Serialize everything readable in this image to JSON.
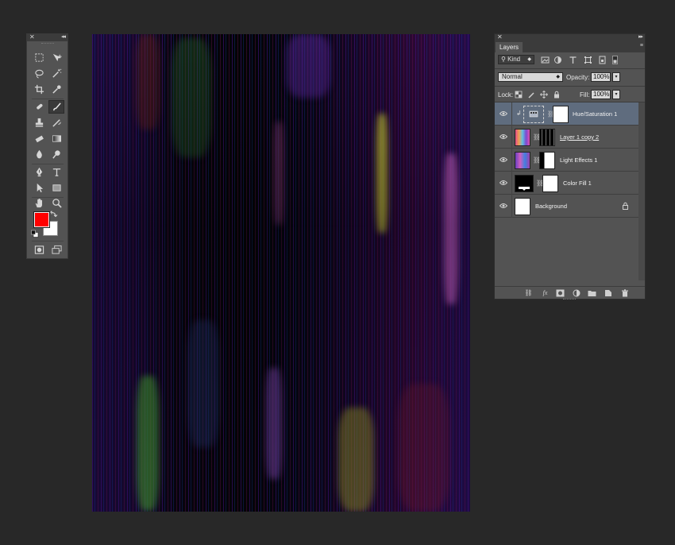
{
  "toolbox": {
    "close_glyph": "✕",
    "collapse_glyph": "◂◂",
    "tools": [
      {
        "name": "rectangular-marquee-tool-icon",
        "glyph": "⬚"
      },
      {
        "name": "move-tool-icon",
        "glyph": "✥"
      },
      {
        "name": "lasso-tool-icon",
        "glyph": "ଡ"
      },
      {
        "name": "magic-wand-tool-icon",
        "glyph": "✦"
      },
      {
        "name": "crop-tool-icon",
        "glyph": "⌗"
      },
      {
        "name": "eyedropper-tool-icon",
        "glyph": "✎"
      },
      {
        "name": "healing-brush-tool-icon",
        "glyph": "✚"
      },
      {
        "name": "brush-tool-icon",
        "glyph": "⁄"
      },
      {
        "name": "clone-stamp-tool-icon",
        "glyph": "⊥"
      },
      {
        "name": "history-brush-tool-icon",
        "glyph": "↯"
      },
      {
        "name": "eraser-tool-icon",
        "glyph": "◪"
      },
      {
        "name": "gradient-tool-icon",
        "glyph": "▭"
      },
      {
        "name": "blur-tool-icon",
        "glyph": "◖"
      },
      {
        "name": "dodge-tool-icon",
        "glyph": "●"
      },
      {
        "name": "pen-tool-icon",
        "glyph": "✒"
      },
      {
        "name": "type-tool-icon",
        "glyph": "T"
      },
      {
        "name": "path-selection-tool-icon",
        "glyph": "➤"
      },
      {
        "name": "rectangle-tool-icon",
        "glyph": "▭"
      },
      {
        "name": "hand-tool-icon",
        "glyph": "✋"
      },
      {
        "name": "zoom-tool-icon",
        "glyph": "⚲"
      }
    ],
    "foreground_color": "#ff0000",
    "background_color": "#ffffff"
  },
  "layers_panel": {
    "close_glyph": "✕",
    "collapse_glyph": "▸▸",
    "tab_label": "Layers",
    "menu_glyph": "≡",
    "filter_label": "Kind",
    "blend_mode": "Normal",
    "opacity_label": "Opacity:",
    "opacity_value": "100%",
    "lock_label": "Lock:",
    "fill_label": "Fill:",
    "fill_value": "100%",
    "layers": [
      {
        "name": "Hue/Saturation 1",
        "selected": true
      },
      {
        "name": "Layer 1 copy 2",
        "selected": false
      },
      {
        "name": "Light Effects 1",
        "selected": false
      },
      {
        "name": "Color Fill 1",
        "selected": false
      },
      {
        "name": "Background",
        "selected": false
      }
    ]
  }
}
